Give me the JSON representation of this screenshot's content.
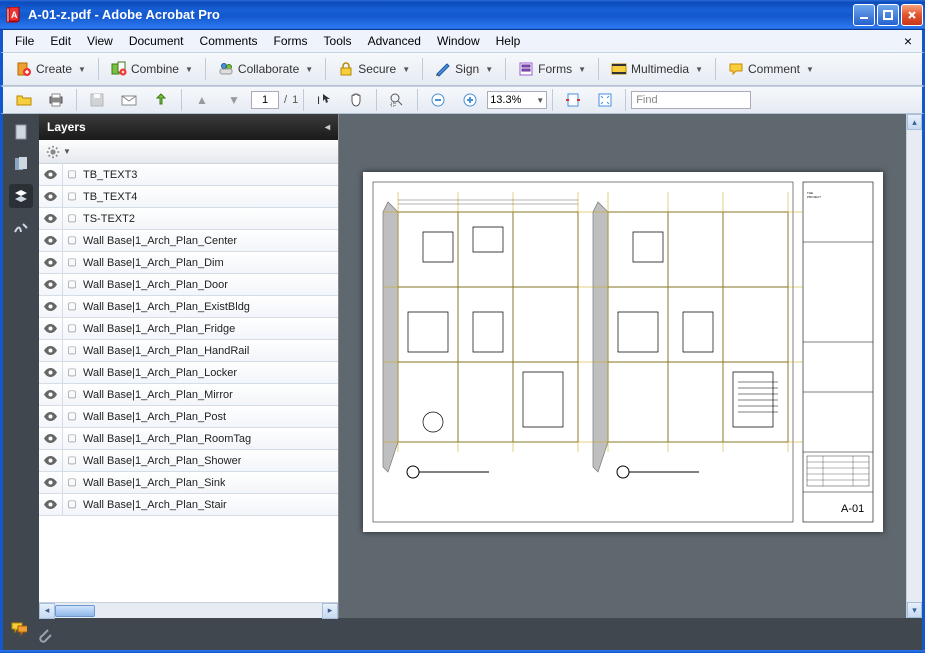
{
  "window": {
    "title": "A-01-z.pdf - Adobe Acrobat Pro"
  },
  "menu": {
    "items": [
      "File",
      "Edit",
      "View",
      "Document",
      "Comments",
      "Forms",
      "Tools",
      "Advanced",
      "Window",
      "Help"
    ]
  },
  "toolbar1": {
    "create": "Create",
    "combine": "Combine",
    "collaborate": "Collaborate",
    "secure": "Secure",
    "sign": "Sign",
    "forms": "Forms",
    "multimedia": "Multimedia",
    "comment": "Comment"
  },
  "toolbar2": {
    "page_current": "1",
    "page_sep": "/",
    "page_total": "1",
    "zoom_value": "13.3%",
    "find_placeholder": "Find"
  },
  "layers_panel": {
    "title": "Layers",
    "items": [
      "TB_TEXT3",
      "TB_TEXT4",
      "TS-TEXT2",
      "Wall Base|1_Arch_Plan_Center",
      "Wall Base|1_Arch_Plan_Dim",
      "Wall Base|1_Arch_Plan_Door",
      "Wall Base|1_Arch_Plan_ExistBldg",
      "Wall Base|1_Arch_Plan_Fridge",
      "Wall Base|1_Arch_Plan_HandRail",
      "Wall Base|1_Arch_Plan_Locker",
      "Wall Base|1_Arch_Plan_Mirror",
      "Wall Base|1_Arch_Plan_Post",
      "Wall Base|1_Arch_Plan_RoomTag",
      "Wall Base|1_Arch_Plan_Shower",
      "Wall Base|1_Arch_Plan_Sink",
      "Wall Base|1_Arch_Plan_Stair"
    ]
  },
  "sheet": {
    "number": "A-01"
  }
}
